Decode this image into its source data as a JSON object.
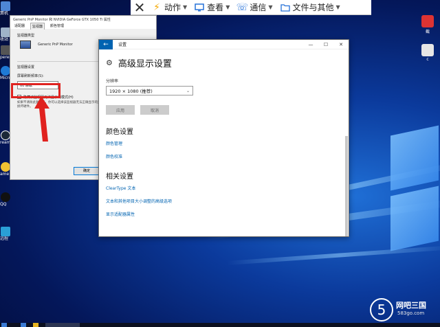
{
  "toolbar": {
    "close_icon": "close-icon",
    "items": [
      {
        "label": "动作",
        "icon": "lightning-icon",
        "color": "#f5a800"
      },
      {
        "label": "查看",
        "icon": "monitor-icon",
        "color": "#2470d8"
      },
      {
        "label": "通信",
        "icon": "phone-icon",
        "color": "#2470d8"
      },
      {
        "label": "文件与其他",
        "icon": "folder-icon",
        "color": "#2470d8"
      }
    ]
  },
  "desktop": {
    "left_icons": [
      {
        "label": "算机"
      },
      {
        "label": "收站"
      },
      {
        "label": "pere"
      },
      {
        "label": "Micros Edge"
      },
      {
        "label": "ream"
      },
      {
        "label": "ame"
      },
      {
        "label": "QQ"
      },
      {
        "label": "远程"
      }
    ],
    "right_icons": [
      {
        "label": "截"
      },
      {
        "label": "c"
      }
    ]
  },
  "props_window": {
    "title": "Generic PnP Monitor 和 NVIDIA GeForce GTX 1050 Ti 属性",
    "tabs": [
      "适配器",
      "监视器",
      "颜色管理"
    ],
    "monitor_type_label": "监视器类型",
    "monitor_name": "Generic PnP Monitor",
    "settings_label": "监视器设置",
    "refresh_label": "屏幕刷新频率(S):",
    "refresh_value": "60 赫兹",
    "hide_modes_label": "隐藏该监视器无法显示的模式(H)",
    "note": "如果不清除此复选框，你可以选择该监视器无法正确显示的显示模式。这样会导致无法使用和/或损坏硬件。",
    "ok_label": "确定"
  },
  "settings_window": {
    "title": "设置",
    "heading": "高级显示设置",
    "resolution_label": "分辨率",
    "resolution_value": "1920 × 1080 (推荐)",
    "apply_label": "应用",
    "cancel_label": "取消",
    "color_section": "颜色设置",
    "color_links": [
      "颜色管理",
      "颜色校准"
    ],
    "related_section": "相关设置",
    "related_links": [
      "ClearType 文本",
      "文本和其他项目大小调整的高级选项",
      "显示适配器属性"
    ]
  },
  "watermark": {
    "digit": "5",
    "name": "网吧三国",
    "site": "583go.com"
  },
  "colors": {
    "accent": "#0063b1",
    "highlight": "#e0221f"
  }
}
